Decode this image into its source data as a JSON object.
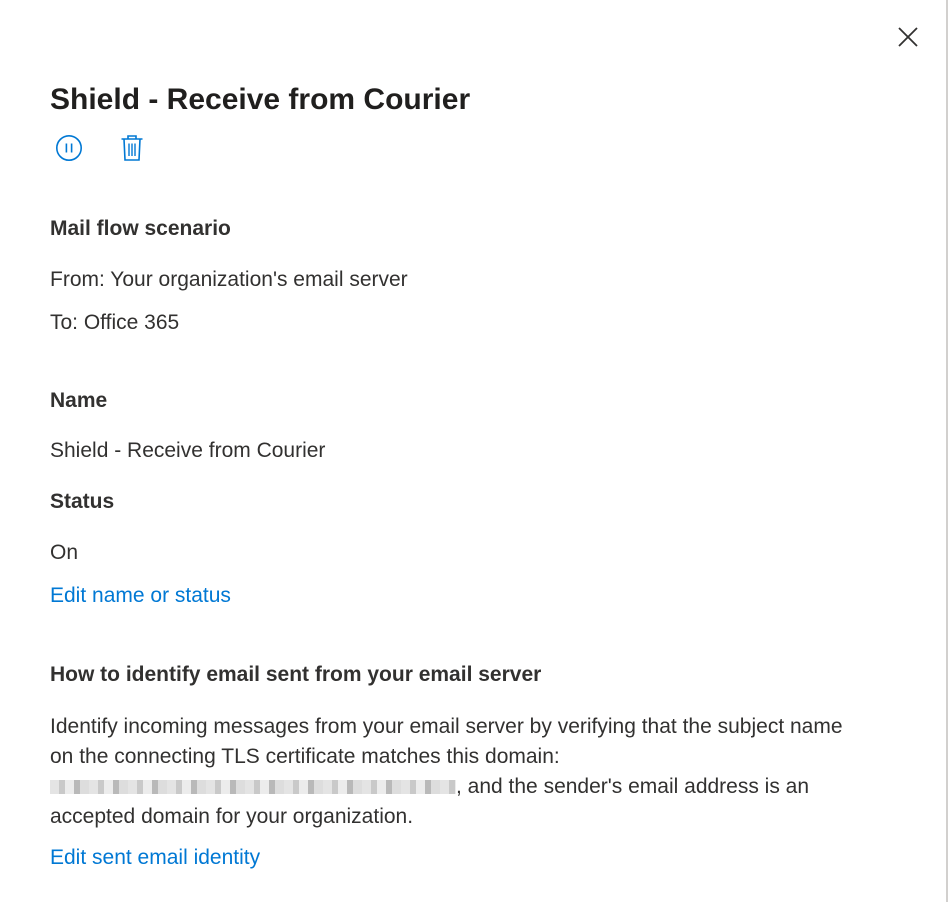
{
  "panel": {
    "title": "Shield - Receive from Courier"
  },
  "toolbar": {
    "icons": [
      "pause-icon",
      "trash-icon"
    ]
  },
  "mail_flow": {
    "heading": "Mail flow scenario",
    "from": "From: Your organization's email server",
    "to": "To: Office 365"
  },
  "name_section": {
    "heading": "Name",
    "value": "Shield - Receive from Courier"
  },
  "status_section": {
    "heading": "Status",
    "value": "On",
    "edit_link": "Edit name or status"
  },
  "identify_section": {
    "heading": "How to identify email sent from your email server",
    "text_part1": "Identify incoming messages from your email server by verifying that the subject name on the connecting TLS certificate matches this domain: ",
    "text_part2": ", and the sender's email address is an accepted domain for your organization.",
    "edit_link": "Edit sent email identity"
  },
  "colors": {
    "accent": "#0078d4",
    "text": "#323130",
    "heading": "#201f1e"
  }
}
